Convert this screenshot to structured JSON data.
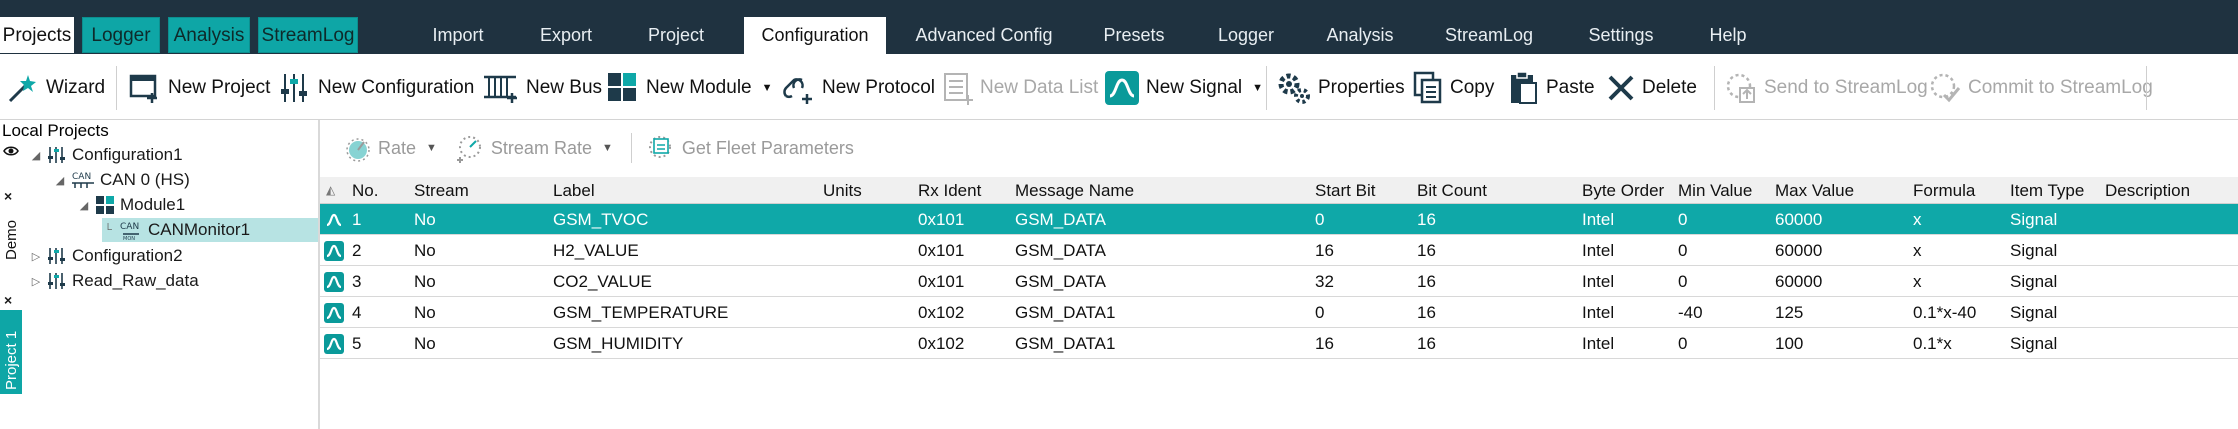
{
  "side_tabs": [
    "Projects",
    "Logger",
    "Analysis",
    "StreamLog"
  ],
  "menu_tabs": [
    "Import",
    "Export",
    "Project",
    "Configuration",
    "Advanced Config",
    "Presets",
    "Logger",
    "Analysis",
    "StreamLog",
    "Settings",
    "Help"
  ],
  "active_menu": "Configuration",
  "toolbar": {
    "wizard": "Wizard",
    "new_project": "New Project",
    "new_configuration": "New Configuration",
    "new_bus": "New Bus",
    "new_module": "New Module",
    "new_protocol": "New Protocol",
    "new_data_list": "New Data List",
    "new_signal": "New Signal",
    "properties": "Properties",
    "copy": "Copy",
    "paste": "Paste",
    "delete": "Delete",
    "send_to_streamlog": "Send to StreamLog",
    "commit_to_streamlog": "Commit to StreamLog"
  },
  "tree": {
    "title": "Local Projects",
    "vertical_tabs": [
      "Demo",
      "Project 1"
    ],
    "nodes": [
      {
        "label": "Configuration1",
        "icon": "configuration-icon"
      },
      {
        "label": "CAN 0 (HS)",
        "icon": "can-bus-icon"
      },
      {
        "label": "Module1",
        "icon": "module-icon"
      },
      {
        "label": "CANMonitor1",
        "icon": "can-monitor-icon"
      },
      {
        "label": "Configuration2",
        "icon": "configuration-icon"
      },
      {
        "label": "Read_Raw_data",
        "icon": "configuration-icon"
      }
    ]
  },
  "grid_toolbar": {
    "rate": "Rate",
    "stream_rate": "Stream Rate",
    "get_fleet_parameters": "Get Fleet Parameters"
  },
  "table": {
    "columns": [
      "No.",
      "Stream",
      "Label",
      "Units",
      "Rx Ident",
      "Message Name",
      "Start Bit",
      "Bit Count",
      "Byte Order",
      "Min Value",
      "Max Value",
      "Formula",
      "Item Type",
      "Description"
    ],
    "rows": [
      [
        "1",
        "No",
        "GSM_TVOC",
        "",
        "0x101",
        "GSM_DATA",
        "0",
        "16",
        "Intel",
        "0",
        "60000",
        "x",
        "Signal",
        ""
      ],
      [
        "2",
        "No",
        "H2_VALUE",
        "",
        "0x101",
        "GSM_DATA",
        "16",
        "16",
        "Intel",
        "0",
        "60000",
        "x",
        "Signal",
        ""
      ],
      [
        "3",
        "No",
        "CO2_VALUE",
        "",
        "0x101",
        "GSM_DATA",
        "32",
        "16",
        "Intel",
        "0",
        "60000",
        "x",
        "Signal",
        ""
      ],
      [
        "4",
        "No",
        "GSM_TEMPERATURE",
        "",
        "0x102",
        "GSM_DATA1",
        "0",
        "16",
        "Intel",
        "-40",
        "125",
        "0.1*x-40",
        "Signal",
        ""
      ],
      [
        "5",
        "No",
        "GSM_HUMIDITY",
        "",
        "0x102",
        "GSM_DATA1",
        "16",
        "16",
        "Intel",
        "0",
        "100",
        "0.1*x",
        "Signal",
        ""
      ]
    ]
  },
  "colors": {
    "accent": "#0fa8a8",
    "topbar": "#1f3240",
    "tree_selected": "#b7e3e3"
  }
}
